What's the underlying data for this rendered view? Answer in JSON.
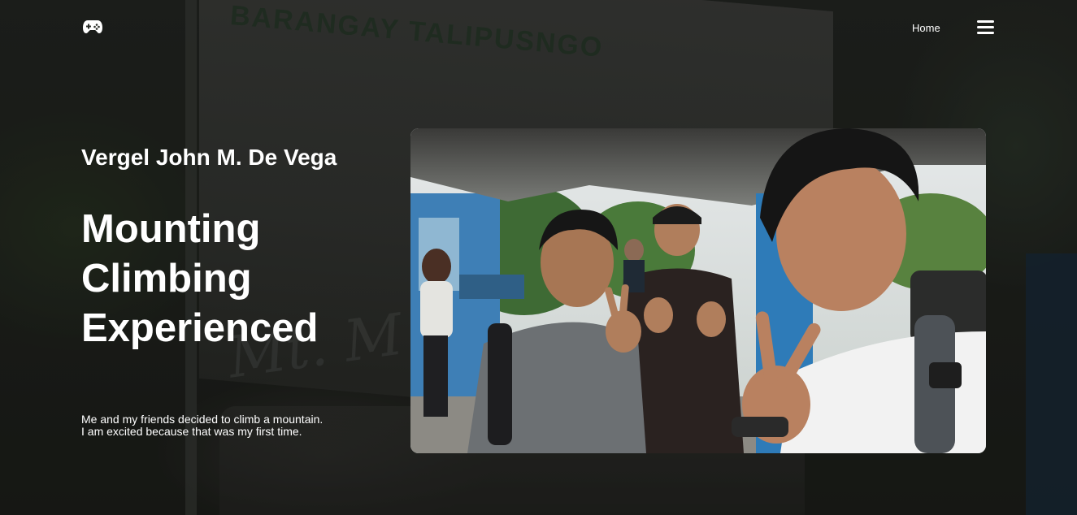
{
  "nav": {
    "logo_icon": "gamepad-icon",
    "home_label": "Home",
    "menu_icon": "hamburger-menu-icon"
  },
  "background": {
    "sign_line1": "BARANGAY TALIPUSNGO",
    "script_text": "Mt. M"
  },
  "hero": {
    "author": "Vergel John M. De Vega",
    "headline": [
      "Mounting",
      "Climbing",
      "Experienced"
    ],
    "description": [
      "Me and my friends decided to climb a mountain.",
      "I am excited because that was my first time."
    ]
  },
  "colors": {
    "text": "#ffffff",
    "overlay": "#000000"
  }
}
